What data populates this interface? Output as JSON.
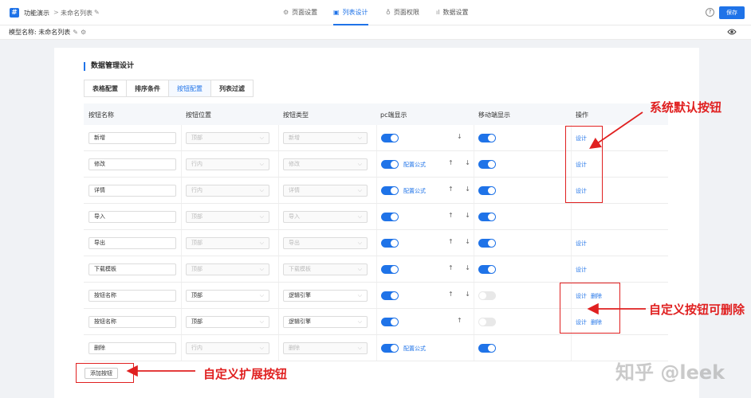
{
  "header": {
    "logo_glyph": "#",
    "breadcrumb_app": "功能演示",
    "breadcrumb_sep": ">",
    "breadcrumb_page": "未命名列表",
    "nav_tabs": [
      {
        "icon": "⚙",
        "label": "页面设置"
      },
      {
        "icon": "▣",
        "label": "列表设计"
      },
      {
        "icon": "♁",
        "label": "页面权限"
      },
      {
        "icon": "ıl",
        "label": "数据设置"
      }
    ],
    "help_glyph": "?",
    "save_label": "保存"
  },
  "subbar": {
    "model_label": "模型名称: 未命名列表"
  },
  "card": {
    "title": "数据管理设计",
    "tabs": [
      "表格配置",
      "排序条件",
      "按钮配置",
      "列表过滤"
    ],
    "active_tab": 2
  },
  "table": {
    "columns": [
      "按钮名称",
      "按钮位置",
      "按钮类型",
      "pc端显示",
      "移动端显示",
      "操作"
    ],
    "rows": [
      {
        "name": "新增",
        "position": "顶部",
        "type": "新增",
        "pos_disabled": true,
        "pc_on": true,
        "formula": "",
        "arrows": "↓",
        "mobile_on": true,
        "ops": [
          "设计"
        ]
      },
      {
        "name": "修改",
        "position": "行内",
        "type": "修改",
        "pos_disabled": true,
        "pc_on": true,
        "formula": "配置公式",
        "arrows": "↑ ↓",
        "mobile_on": true,
        "ops": [
          "设计"
        ]
      },
      {
        "name": "详情",
        "position": "行内",
        "type": "详情",
        "pos_disabled": true,
        "pc_on": true,
        "formula": "配置公式",
        "arrows": "↑ ↓",
        "mobile_on": true,
        "ops": [
          "设计"
        ]
      },
      {
        "name": "导入",
        "position": "顶部",
        "type": "导入",
        "pos_disabled": true,
        "pc_on": true,
        "formula": "",
        "arrows": "↑ ↓",
        "mobile_on": true,
        "ops": []
      },
      {
        "name": "导出",
        "position": "顶部",
        "type": "导出",
        "pos_disabled": true,
        "pc_on": true,
        "formula": "",
        "arrows": "↑ ↓",
        "mobile_on": true,
        "ops": [
          "设计"
        ]
      },
      {
        "name": "下载模板",
        "position": "顶部",
        "type": "下载模板",
        "pos_disabled": true,
        "pc_on": true,
        "formula": "",
        "arrows": "↑ ↓",
        "mobile_on": true,
        "ops": [
          "设计"
        ]
      },
      {
        "name": "按钮名称",
        "position": "顶部",
        "type": "逻辑引擎",
        "pos_disabled": false,
        "pc_on": true,
        "formula": "",
        "arrows": "↑ ↓",
        "mobile_on": false,
        "ops": [
          "设计",
          "删除"
        ]
      },
      {
        "name": "按钮名称",
        "position": "顶部",
        "type": "逻辑引擎",
        "pos_disabled": false,
        "pc_on": true,
        "formula": "",
        "arrows": "↑",
        "mobile_on": false,
        "ops": [
          "设计",
          "删除"
        ]
      },
      {
        "name": "删除",
        "position": "行内",
        "type": "删除",
        "pos_disabled": true,
        "pc_on": true,
        "formula": "配置公式",
        "arrows": "",
        "mobile_on": true,
        "ops": []
      }
    ],
    "add_button_label": "添加按钮"
  },
  "annotations": {
    "system_default": "系统默认按钮",
    "custom_deletable": "自定义按钮可删除",
    "custom_extend": "自定义扩展按钮",
    "color": "#e02020"
  },
  "watermark": "知乎 @leek",
  "colors": {
    "accent": "#1f73e8"
  }
}
